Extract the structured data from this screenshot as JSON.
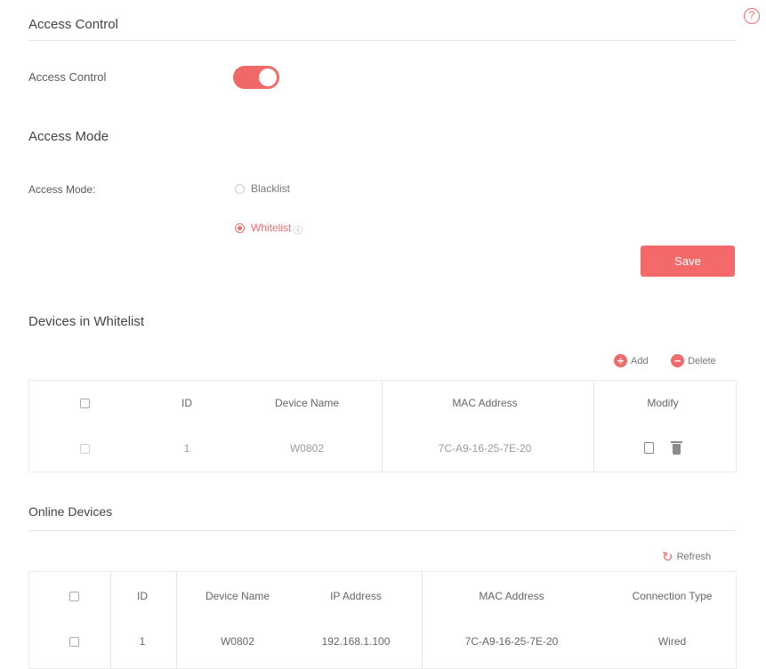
{
  "access_control": {
    "section_title": "Access Control",
    "help_glyph": "?",
    "toggle_label": "Access Control",
    "toggle_on": true
  },
  "access_mode": {
    "section_title": "Access Mode",
    "field_label": "Access Mode:",
    "options": [
      {
        "label": "Blacklist",
        "selected": false
      },
      {
        "label": "Whitelist",
        "selected": true
      }
    ],
    "save_label": "Save"
  },
  "whitelist": {
    "section_title": "Devices in Whitelist",
    "add_label": "Add",
    "delete_label": "Delete",
    "columns": [
      "ID",
      "Device Name",
      "MAC Address",
      "Modify"
    ],
    "rows": [
      {
        "id": "1",
        "device_name": "W0802",
        "mac": "7C-A9-16-25-7E-20"
      }
    ]
  },
  "online": {
    "section_title": "Online Devices",
    "refresh_label": "Refresh",
    "columns": [
      "ID",
      "Device Name",
      "IP Address",
      "MAC Address",
      "Connection Type"
    ],
    "rows": [
      {
        "id": "1",
        "device_name": "W0802",
        "ip": "192.168.1.100",
        "mac": "7C-A9-16-25-7E-20",
        "connection": "Wired"
      }
    ]
  },
  "colors": {
    "accent": "#f06b6b",
    "text": "#4a4a4a",
    "rule": "#e3e3e3"
  }
}
